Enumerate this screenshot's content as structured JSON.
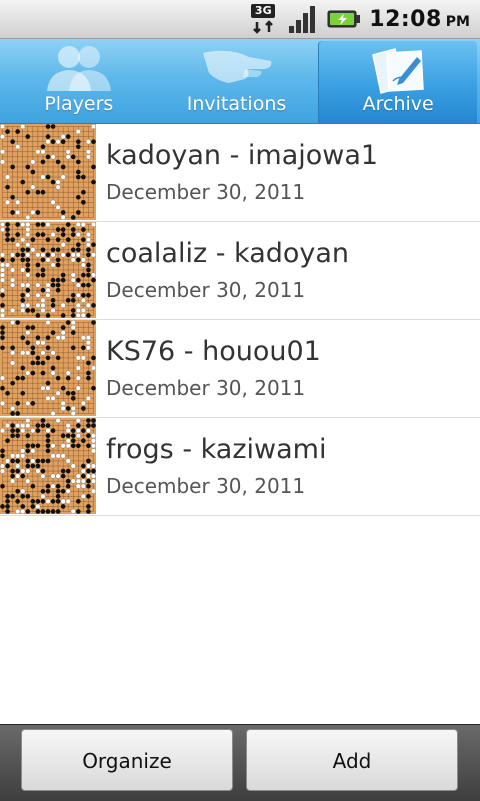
{
  "status_bar": {
    "network": "3G",
    "time": "12:08",
    "ampm": "PM",
    "icons": [
      "3g-data-icon",
      "signal-icon",
      "battery-charging-icon"
    ]
  },
  "tabs": [
    {
      "label": "Players",
      "icon": "players-icon",
      "selected": false
    },
    {
      "label": "Invitations",
      "icon": "handshake-icon",
      "selected": false
    },
    {
      "label": "Archive",
      "icon": "archive-icon",
      "selected": true
    }
  ],
  "games": [
    {
      "title": "kadoyan - imajowa1",
      "date": "December 30, 2011"
    },
    {
      "title": "coalaliz - kadoyan",
      "date": "December 30, 2011"
    },
    {
      "title": "KS76 - houou01",
      "date": "December 30, 2011"
    },
    {
      "title": "frogs - kaziwami",
      "date": "December 30, 2011"
    }
  ],
  "buttons": {
    "organize": "Organize",
    "add": "Add"
  },
  "colors": {
    "tab_bar": "#5fb8ea",
    "board": "#e0a060"
  }
}
